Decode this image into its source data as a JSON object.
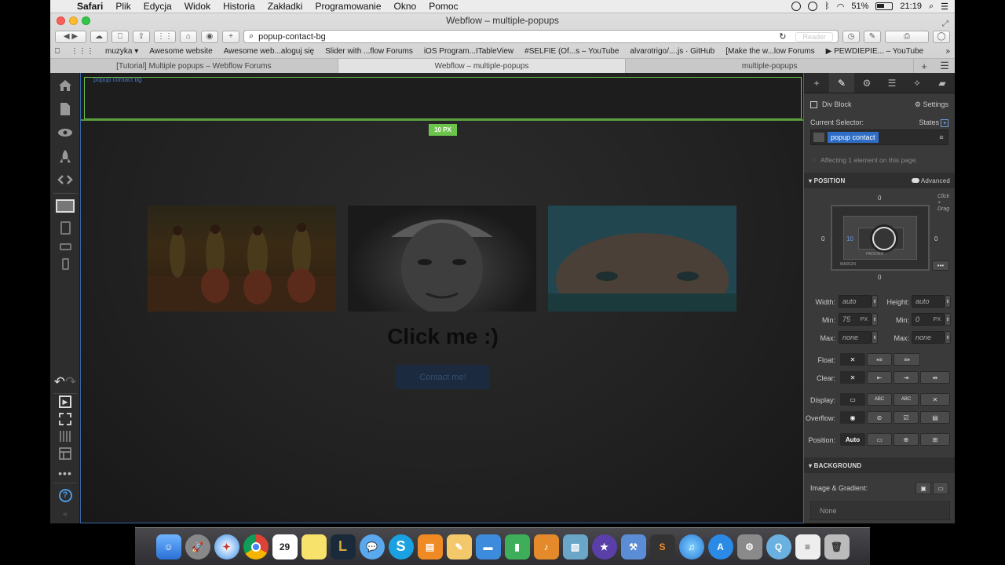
{
  "menubar": {
    "items": [
      "Safari",
      "Plik",
      "Edycja",
      "Widok",
      "Historia",
      "Zakładki",
      "Programowanie",
      "Okno",
      "Pomoc"
    ],
    "battery": "51%",
    "clock": "21:19"
  },
  "safari": {
    "window_title": "Webflow – multiple-popups",
    "address": "popup-contact-bg",
    "reader_label": "Reader",
    "bookmarks": [
      "muzyka ▾",
      "Awesome website",
      "Awesome web...aloguj się",
      "Slider with ...flow Forums",
      "iOS Program...ITableView",
      "#SELFIE (Of...s – YouTube",
      "alvarotrigo/....js · GitHub",
      "[Make the w...low Forums",
      "▶ PEWDIEPIE... – YouTube"
    ],
    "tabs": [
      "[Tutorial] Multiple popups – Webflow Forums",
      "Webflow – multiple-popups",
      "multiple-popups"
    ],
    "active_tab": 1
  },
  "canvas": {
    "selected_label": "popup contact bg",
    "margin_badge": "10 PX",
    "headline": "Click me :)",
    "button_label": "Contact me!",
    "images": [
      "colorful-dancers-photo",
      "old-man-portrait-photo",
      "child-face-photo"
    ]
  },
  "panel": {
    "element_type": "Div Block",
    "settings_label": "Settings",
    "current_selector_label": "Current Selector:",
    "states_label": "States",
    "selector_tag": "popup contact",
    "affecting_text": "Affecting 1 element on this page.",
    "position_section": "POSITION",
    "advanced_label": "Advanced",
    "box": {
      "top": "0",
      "left": "0",
      "right": "0",
      "bottom": "0",
      "inner_left": "10",
      "padding_label": "PADDING",
      "margin_label": "MARGIN",
      "click_drag": "Click + Drag"
    },
    "width_label": "Width:",
    "width_value": "auto",
    "height_label": "Height:",
    "height_value": "auto",
    "min_label": "Min:",
    "min_w": "75",
    "min_w_unit": "PX",
    "min_h": "0",
    "min_h_unit": "PX",
    "max_label": "Max:",
    "max_w": "none",
    "max_h": "none",
    "float_label": "Float:",
    "clear_label": "Clear:",
    "display_label": "Display:",
    "display_options": [
      "ABC",
      "ABC"
    ],
    "overflow_label": "Overflow:",
    "position_label": "Position:",
    "position_value": "Auto",
    "background_section": "BACKGROUND",
    "image_gradient_label": "Image & Gradient:",
    "bg_value": "None"
  },
  "colors": {
    "accent_green": "#6cc44a",
    "selector_blue": "#2f6ec7",
    "panel_bg": "#3a3a3a"
  },
  "dock": {
    "icons": [
      "finder-icon",
      "launchpad-icon",
      "safari-icon",
      "chrome-icon",
      "calendar-icon",
      "notes-icon",
      "lol-icon",
      "messages-icon",
      "skype-icon",
      "ibooks-icon",
      "sketch-icon",
      "keynote-icon",
      "numbers-icon",
      "garageband-icon",
      "preview-icon",
      "imovie-icon",
      "xcode-icon",
      "sublime-icon",
      "itunes-icon",
      "appstore-icon",
      "system-prefs-icon",
      "quicktime-icon",
      "documents-icon",
      "trash-icon"
    ],
    "calendar_day": "29"
  }
}
